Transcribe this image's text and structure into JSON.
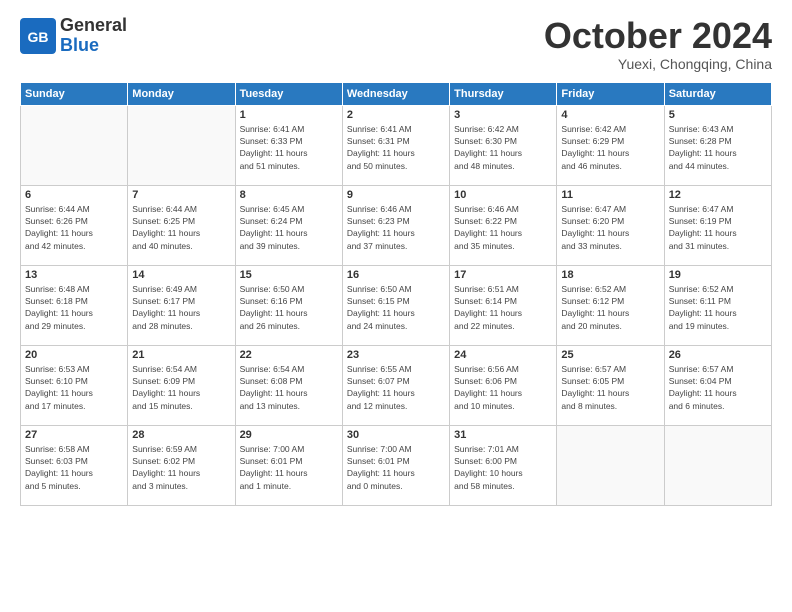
{
  "header": {
    "logo_general": "General",
    "logo_blue": "Blue",
    "month_title": "October 2024",
    "subtitle": "Yuexi, Chongqing, China"
  },
  "days_of_week": [
    "Sunday",
    "Monday",
    "Tuesday",
    "Wednesday",
    "Thursday",
    "Friday",
    "Saturday"
  ],
  "weeks": [
    [
      {
        "day": "",
        "info": ""
      },
      {
        "day": "",
        "info": ""
      },
      {
        "day": "1",
        "info": "Sunrise: 6:41 AM\nSunset: 6:33 PM\nDaylight: 11 hours\nand 51 minutes."
      },
      {
        "day": "2",
        "info": "Sunrise: 6:41 AM\nSunset: 6:31 PM\nDaylight: 11 hours\nand 50 minutes."
      },
      {
        "day": "3",
        "info": "Sunrise: 6:42 AM\nSunset: 6:30 PM\nDaylight: 11 hours\nand 48 minutes."
      },
      {
        "day": "4",
        "info": "Sunrise: 6:42 AM\nSunset: 6:29 PM\nDaylight: 11 hours\nand 46 minutes."
      },
      {
        "day": "5",
        "info": "Sunrise: 6:43 AM\nSunset: 6:28 PM\nDaylight: 11 hours\nand 44 minutes."
      }
    ],
    [
      {
        "day": "6",
        "info": "Sunrise: 6:44 AM\nSunset: 6:26 PM\nDaylight: 11 hours\nand 42 minutes."
      },
      {
        "day": "7",
        "info": "Sunrise: 6:44 AM\nSunset: 6:25 PM\nDaylight: 11 hours\nand 40 minutes."
      },
      {
        "day": "8",
        "info": "Sunrise: 6:45 AM\nSunset: 6:24 PM\nDaylight: 11 hours\nand 39 minutes."
      },
      {
        "day": "9",
        "info": "Sunrise: 6:46 AM\nSunset: 6:23 PM\nDaylight: 11 hours\nand 37 minutes."
      },
      {
        "day": "10",
        "info": "Sunrise: 6:46 AM\nSunset: 6:22 PM\nDaylight: 11 hours\nand 35 minutes."
      },
      {
        "day": "11",
        "info": "Sunrise: 6:47 AM\nSunset: 6:20 PM\nDaylight: 11 hours\nand 33 minutes."
      },
      {
        "day": "12",
        "info": "Sunrise: 6:47 AM\nSunset: 6:19 PM\nDaylight: 11 hours\nand 31 minutes."
      }
    ],
    [
      {
        "day": "13",
        "info": "Sunrise: 6:48 AM\nSunset: 6:18 PM\nDaylight: 11 hours\nand 29 minutes."
      },
      {
        "day": "14",
        "info": "Sunrise: 6:49 AM\nSunset: 6:17 PM\nDaylight: 11 hours\nand 28 minutes."
      },
      {
        "day": "15",
        "info": "Sunrise: 6:50 AM\nSunset: 6:16 PM\nDaylight: 11 hours\nand 26 minutes."
      },
      {
        "day": "16",
        "info": "Sunrise: 6:50 AM\nSunset: 6:15 PM\nDaylight: 11 hours\nand 24 minutes."
      },
      {
        "day": "17",
        "info": "Sunrise: 6:51 AM\nSunset: 6:14 PM\nDaylight: 11 hours\nand 22 minutes."
      },
      {
        "day": "18",
        "info": "Sunrise: 6:52 AM\nSunset: 6:12 PM\nDaylight: 11 hours\nand 20 minutes."
      },
      {
        "day": "19",
        "info": "Sunrise: 6:52 AM\nSunset: 6:11 PM\nDaylight: 11 hours\nand 19 minutes."
      }
    ],
    [
      {
        "day": "20",
        "info": "Sunrise: 6:53 AM\nSunset: 6:10 PM\nDaylight: 11 hours\nand 17 minutes."
      },
      {
        "day": "21",
        "info": "Sunrise: 6:54 AM\nSunset: 6:09 PM\nDaylight: 11 hours\nand 15 minutes."
      },
      {
        "day": "22",
        "info": "Sunrise: 6:54 AM\nSunset: 6:08 PM\nDaylight: 11 hours\nand 13 minutes."
      },
      {
        "day": "23",
        "info": "Sunrise: 6:55 AM\nSunset: 6:07 PM\nDaylight: 11 hours\nand 12 minutes."
      },
      {
        "day": "24",
        "info": "Sunrise: 6:56 AM\nSunset: 6:06 PM\nDaylight: 11 hours\nand 10 minutes."
      },
      {
        "day": "25",
        "info": "Sunrise: 6:57 AM\nSunset: 6:05 PM\nDaylight: 11 hours\nand 8 minutes."
      },
      {
        "day": "26",
        "info": "Sunrise: 6:57 AM\nSunset: 6:04 PM\nDaylight: 11 hours\nand 6 minutes."
      }
    ],
    [
      {
        "day": "27",
        "info": "Sunrise: 6:58 AM\nSunset: 6:03 PM\nDaylight: 11 hours\nand 5 minutes."
      },
      {
        "day": "28",
        "info": "Sunrise: 6:59 AM\nSunset: 6:02 PM\nDaylight: 11 hours\nand 3 minutes."
      },
      {
        "day": "29",
        "info": "Sunrise: 7:00 AM\nSunset: 6:01 PM\nDaylight: 11 hours\nand 1 minute."
      },
      {
        "day": "30",
        "info": "Sunrise: 7:00 AM\nSunset: 6:01 PM\nDaylight: 11 hours\nand 0 minutes."
      },
      {
        "day": "31",
        "info": "Sunrise: 7:01 AM\nSunset: 6:00 PM\nDaylight: 10 hours\nand 58 minutes."
      },
      {
        "day": "",
        "info": ""
      },
      {
        "day": "",
        "info": ""
      }
    ]
  ]
}
